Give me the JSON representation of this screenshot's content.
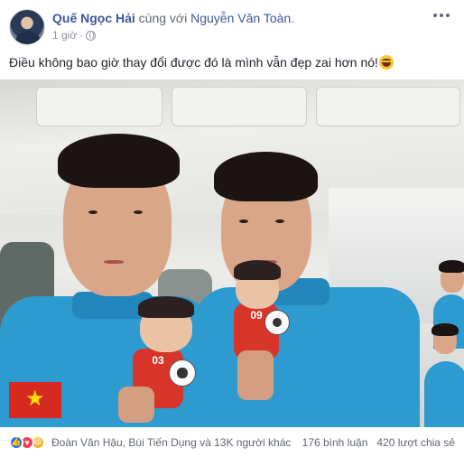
{
  "post": {
    "author": "Quế Ngọc Hải",
    "with_text": " cùng với ",
    "tagged": "Nguyễn Văn Toàn",
    "tagged_suffix": ".",
    "time": "1 giờ",
    "time_separator": " · ",
    "status_text": "Điều không bao giờ thay đổi được đó là mình vẫn đẹp zai hơn nó!",
    "photo_icons": {
      "emoji": "laughing-emoji-icon",
      "privacy": "globe-icon",
      "menu": "more-options-icon"
    },
    "doll_numbers": [
      "03",
      "09"
    ]
  },
  "footer": {
    "reaction_icons": [
      "like-icon",
      "love-icon",
      "haha-icon"
    ],
    "reactors": "Đoàn Văn Hậu, Bùi Tiến Dụng và 13K người khác",
    "comments": "176 bình luận",
    "shares": "420 lượt chia sẻ"
  },
  "colors": {
    "link": "#385898",
    "meta": "#90949c",
    "jersey": "#2d9ad0",
    "doll_red": "#d7352a"
  }
}
